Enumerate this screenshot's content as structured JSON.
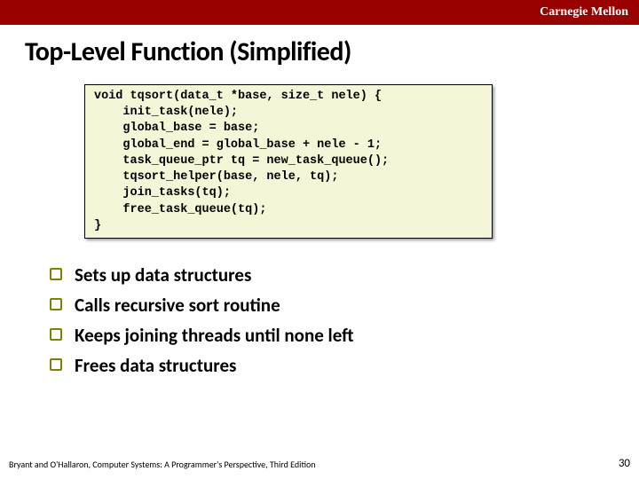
{
  "header": {
    "brand": "Carnegie Mellon"
  },
  "title": "Top-Level Function (Simplified)",
  "code": "void tqsort(data_t *base, size_t nele) {\n    init_task(nele);\n    global_base = base;\n    global_end = global_base + nele - 1;\n    task_queue_ptr tq = new_task_queue();\n    tqsort_helper(base, nele, tq);\n    join_tasks(tq);\n    free_task_queue(tq);\n}",
  "bullets": [
    "Sets up data structures",
    "Calls recursive sort routine",
    "Keeps joining threads until none left",
    "Frees data structures"
  ],
  "footer": {
    "left": "Bryant and O'Hallaron, Computer Systems: A Programmer's Perspective, Third Edition",
    "page": "30"
  }
}
